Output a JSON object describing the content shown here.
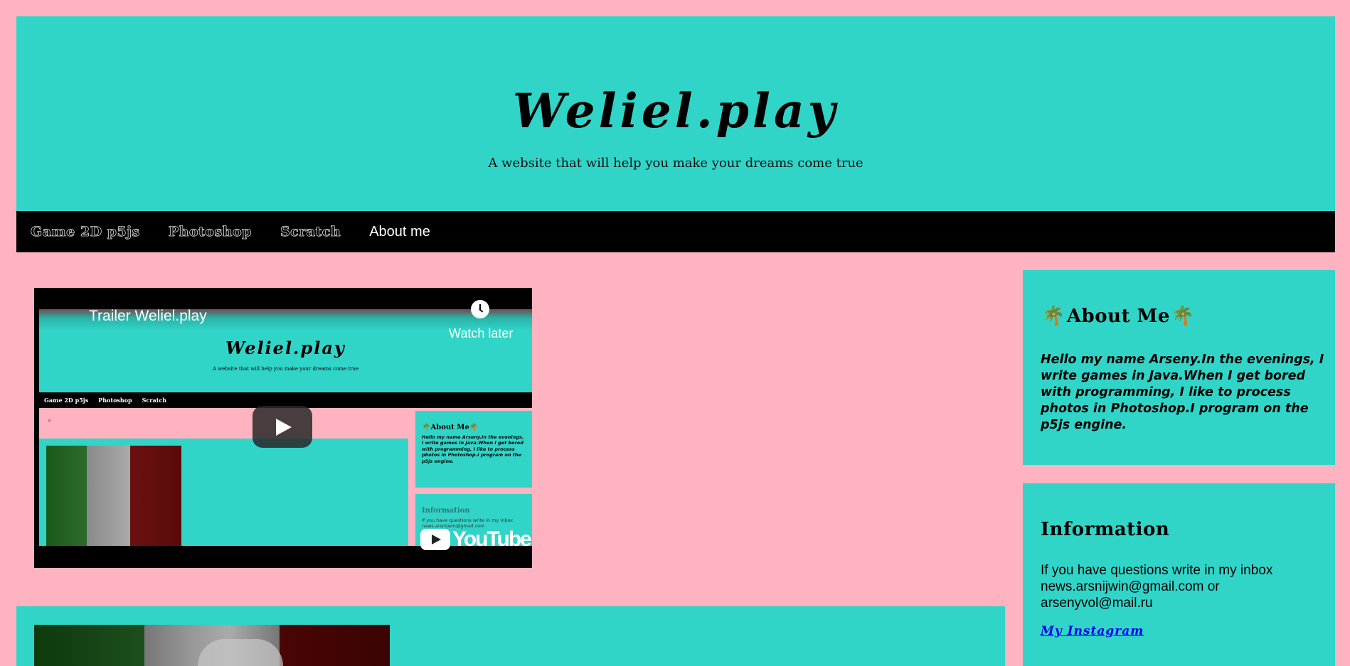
{
  "header": {
    "title": "Weliel.play",
    "tagline": "A website that will help you make your dreams come true"
  },
  "nav": {
    "items": [
      {
        "label": "Game 2D p5js"
      },
      {
        "label": "Photoshop"
      },
      {
        "label": "Scratch"
      },
      {
        "label": "About me"
      }
    ]
  },
  "video": {
    "title": "Trailer Weliel.play",
    "watch_later": "Watch later",
    "youtube_label": "YouTube",
    "preview": {
      "title": "Weliel.play",
      "tagline": "A website that will help you make your dreams come true",
      "nav": [
        "Game 2D p5js",
        "Photoshop",
        "Scratch"
      ],
      "about_heading": "About Me",
      "about_text": "Hello my name Arseny.In the evenings, I write games in Java.When I get bored with programming, I like to process photos in Photoshop.I program on the p5js engine.",
      "info_heading": "Information",
      "info_text": "If you have questions write in my inbox news.arsnijwin@gmail.com"
    }
  },
  "sidebar": {
    "about": {
      "heading": "About Me",
      "palm_icon": "🌴",
      "text": "Hello my name Arseny.In the evenings, I write games in Java.When I get bored with programming, I like to process photos in Photoshop.I program on the p5js engine."
    },
    "info": {
      "heading": "Information",
      "text": "If you have questions write in my inbox news.arsnijwin@gmail.com or arsenyvol@mail.ru",
      "link_label": "My Instagram"
    }
  },
  "colors": {
    "background": "#ffb3c0",
    "accent": "#31d5c8",
    "nav": "#000000"
  }
}
